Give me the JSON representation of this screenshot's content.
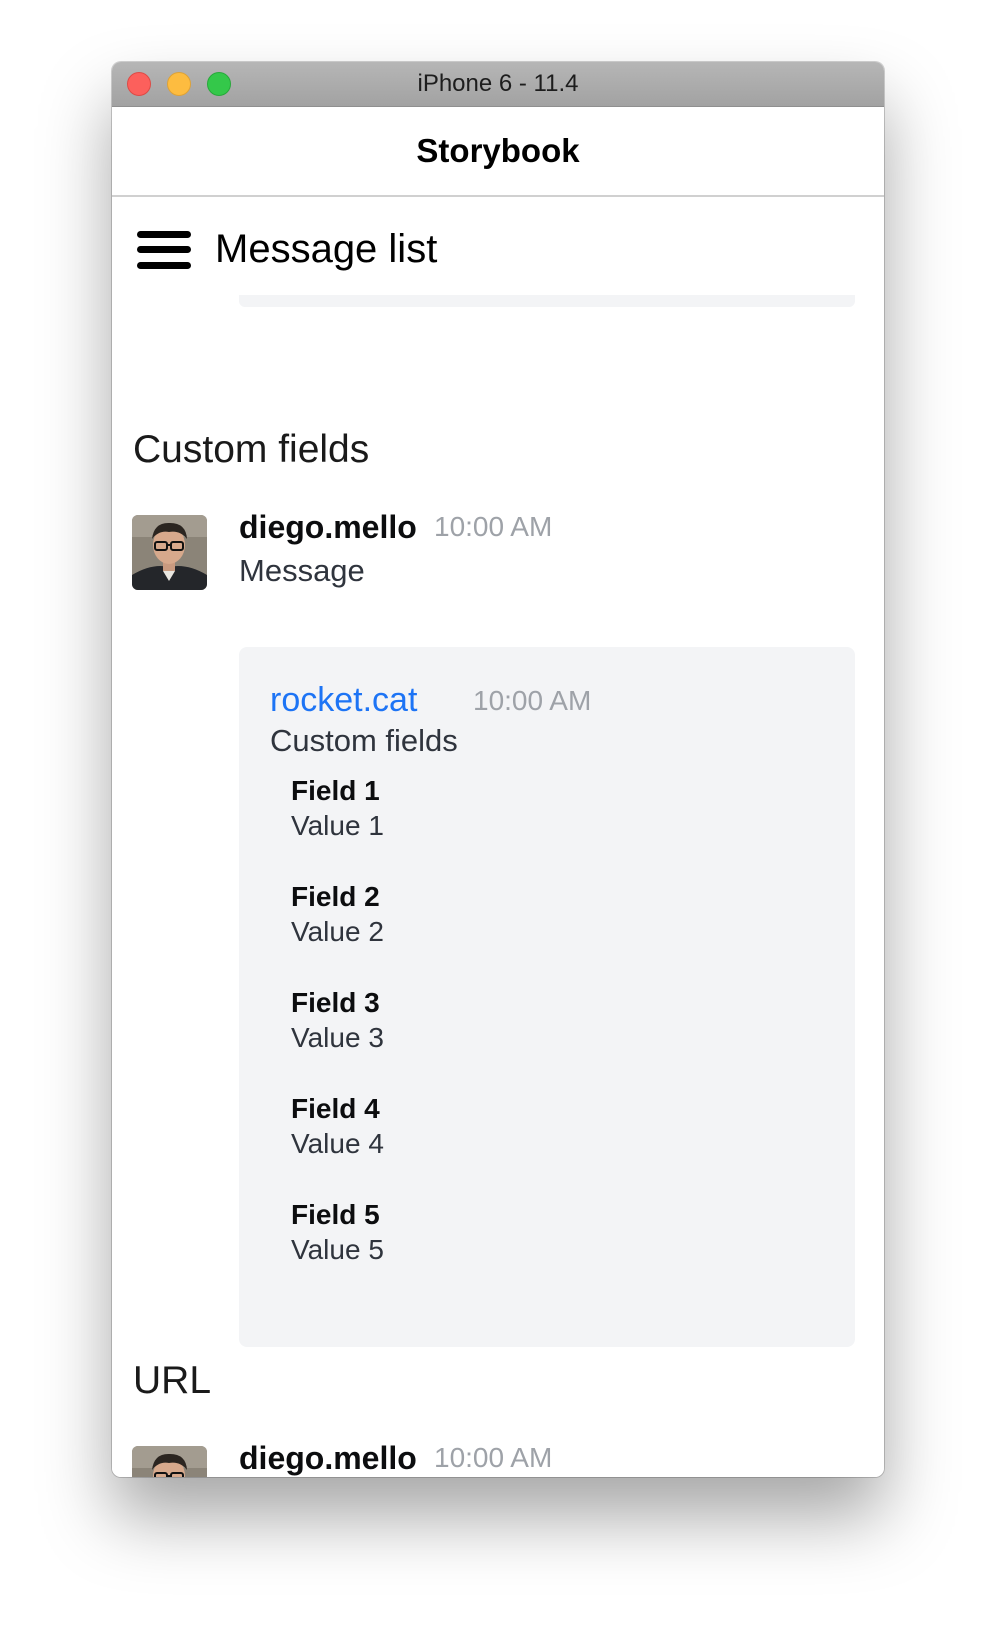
{
  "window": {
    "title": "iPhone 6 - 11.4"
  },
  "navbar": {
    "title": "Storybook"
  },
  "header": {
    "menu_icon": "hamburger-menu-icon",
    "title": "Message list"
  },
  "sections": [
    {
      "title": "Custom fields",
      "message": {
        "username": "diego.mello",
        "time": "10:00 AM",
        "text": "Message",
        "attachment": {
          "author": "rocket.cat",
          "time": "10:00 AM",
          "text": "Custom fields",
          "fields": [
            {
              "title": "Field 1",
              "value": "Value 1"
            },
            {
              "title": "Field 2",
              "value": "Value 2"
            },
            {
              "title": "Field 3",
              "value": "Value 3"
            },
            {
              "title": "Field 4",
              "value": "Value 4"
            },
            {
              "title": "Field 5",
              "value": "Value 5"
            }
          ]
        }
      }
    },
    {
      "title": "URL",
      "message": {
        "username": "diego.mello",
        "time": "10:00 AM"
      }
    }
  ],
  "colors": {
    "link_blue": "#1d74f5",
    "attachment_bg": "#f3f4f6",
    "time_gray": "#9ea2a8"
  }
}
